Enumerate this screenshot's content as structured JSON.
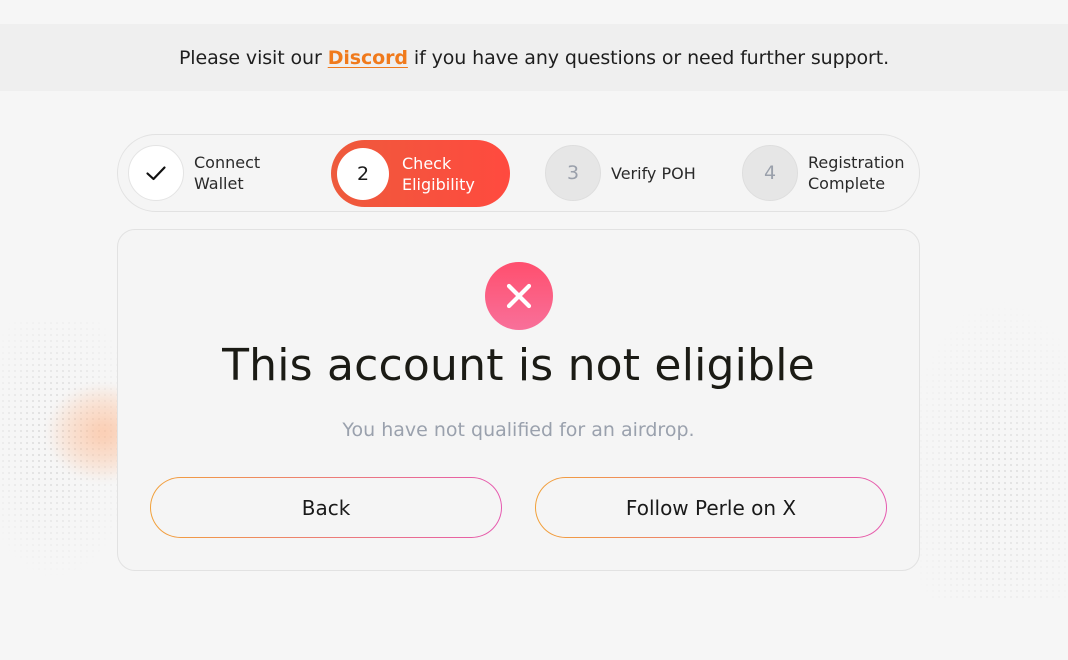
{
  "banner": {
    "prefix": "Please visit our",
    "link_label": "Discord",
    "suffix": "if you have any questions or need further support."
  },
  "stepper": {
    "steps": [
      {
        "number": "",
        "label": "Connect\nWallet",
        "state": "completed",
        "icon": "check-icon"
      },
      {
        "number": "2",
        "label": "Check\nEligibility",
        "state": "active"
      },
      {
        "number": "3",
        "label": "Verify POH",
        "state": "pending"
      },
      {
        "number": "4",
        "label": "Registration\nComplete",
        "state": "pending"
      }
    ]
  },
  "result": {
    "icon": "close-icon",
    "title": "This account is not eligible",
    "message": "You have not qualified for an airdrop.",
    "back_label": "Back",
    "follow_label": "Follow Perle on X"
  },
  "colors": {
    "accent": "#ff4a3f",
    "link": "#f07a1c",
    "error": "#ff4f6e"
  }
}
